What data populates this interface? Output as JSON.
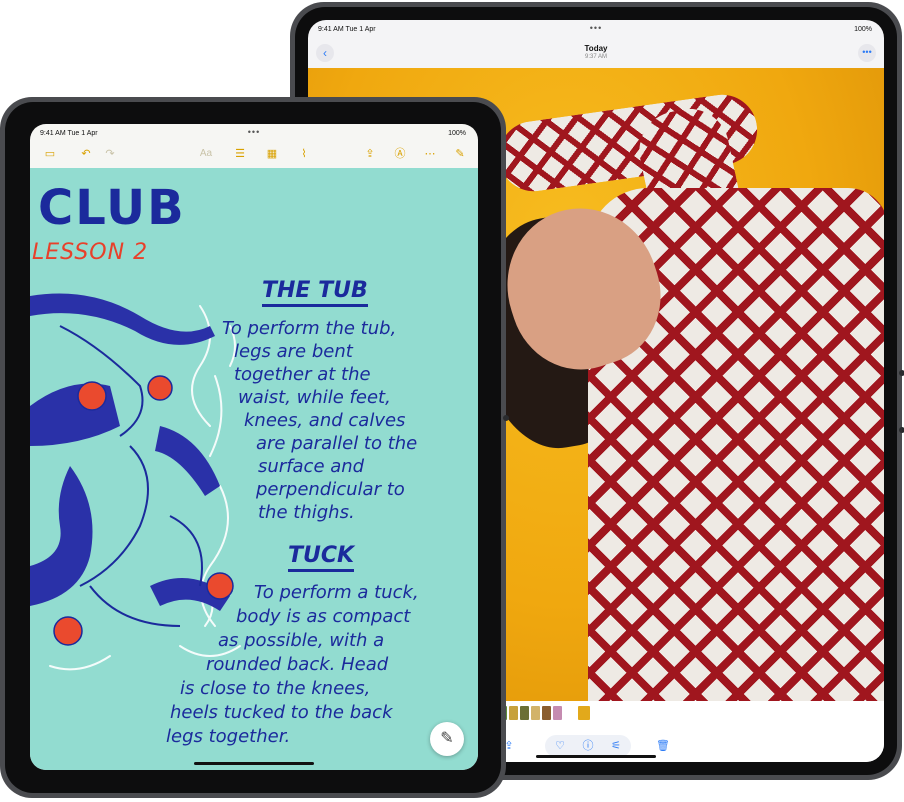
{
  "back_ipad": {
    "status": {
      "time": "9:41 AM  Tue 1 Apr",
      "dots": "•••",
      "battery": "100%"
    },
    "nav": {
      "back_icon": "‹",
      "title": "Today",
      "subtitle": "9:37 AM",
      "more_icon": "•••"
    },
    "toolbar": {
      "share_icon": "⇪",
      "favorite_icon": "♡",
      "info_icon": "ⓘ",
      "adjust_icon": "⚟",
      "delete_icon": "🗑"
    }
  },
  "front_ipad": {
    "status": {
      "time": "9:41 AM  Tue 1 Apr",
      "dots": "•••",
      "battery": "100%"
    },
    "toolbar": {
      "sidebar_icon": "▭",
      "undo_icon": "↶",
      "redo_icon": "↷",
      "format_label": "Aa",
      "checklist_icon": "☰",
      "table_icon": "▦",
      "attach_icon": "⌇",
      "share_icon": "⇪",
      "markup_icon": "Ⓐ",
      "more_icon": "⋯",
      "compose_icon": "✎"
    },
    "note": {
      "title": "CLUB",
      "lesson": "LESSON 2",
      "heading1": "THE TUB",
      "body1": [
        "To perform the tub,",
        "legs are bent",
        "together at the",
        "waist, while feet,",
        "knees, and calves",
        "are parallel to the",
        "surface and",
        "perpendicular to",
        "the thighs."
      ],
      "heading2": "TUCK",
      "body2": [
        "To perform a tuck,",
        "body is as compact",
        "as possible, with a",
        "rounded back. Head",
        "is close to the knees,",
        "heels tucked to the back",
        "legs together."
      ],
      "pencil_icon": "✎"
    }
  },
  "colors": {
    "notes_accent": "#d9a100",
    "photos_accent": "#2d7cf6",
    "ink": "#1b2a9c",
    "canvas": "#92dcd0",
    "lesson_red": "#e8402a"
  }
}
